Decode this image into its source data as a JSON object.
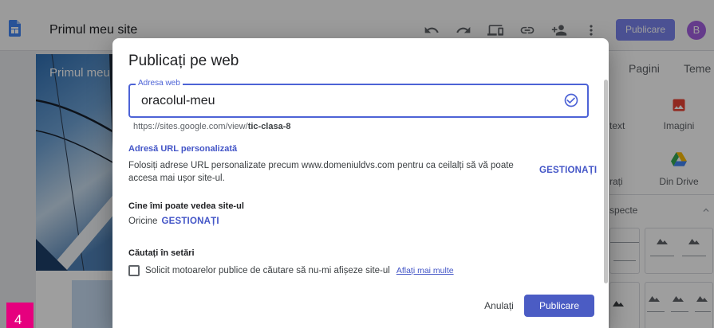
{
  "app": {
    "site_title": "Primul meu site",
    "publish_label": "Publicare",
    "avatar_initial": "B"
  },
  "toolbar_icons": [
    "undo-icon",
    "redo-icon",
    "preview-devices-icon",
    "link-icon",
    "share-person-add-icon",
    "more-vert-icon"
  ],
  "canvas": {
    "header_text": "Primul meu"
  },
  "side_panel": {
    "tabs": [
      {
        "label": "Pagini"
      },
      {
        "label": "Teme"
      }
    ],
    "insert": {
      "text_box_label": "text",
      "images_label": "Imagini",
      "embed_label": "rați",
      "drive_label": "Din Drive"
    },
    "layouts_label": "specte"
  },
  "dialog": {
    "title": "Publicați pe web",
    "address_field": {
      "label": "Adresa web",
      "value": "oracolul-meu"
    },
    "url_prefix": "https://sites.google.com/view/",
    "url_slug": "tic-clasa-8",
    "custom_url": {
      "heading": "Adresă URL personalizată",
      "text": "Folosiți adrese URL personalizate precum www.domeniuldvs.com pentru ca ceilalți să vă poate accesa mai ușor site-ul.",
      "action": "GESTIONAȚI"
    },
    "visibility": {
      "heading": "Cine îmi poate vedea site-ul",
      "value": "Oricine",
      "action": "GESTIONAȚI"
    },
    "search": {
      "heading": "Căutați în setări",
      "checkbox_label": "Solicit motoarelor publice de căutare să nu-mi afișeze site-ul",
      "checked": false,
      "learn_more": "Aflați mai multe"
    },
    "cancel_label": "Anulați",
    "publish_label": "Publicare"
  },
  "page_badge": "4",
  "colors": {
    "accent": "#4355c7",
    "field_border": "#4d63d6",
    "primary_button": "#4b5cc4",
    "page_badge": "#e6007e",
    "avatar": "#a35fe0",
    "images_icon": "#ea4335"
  }
}
